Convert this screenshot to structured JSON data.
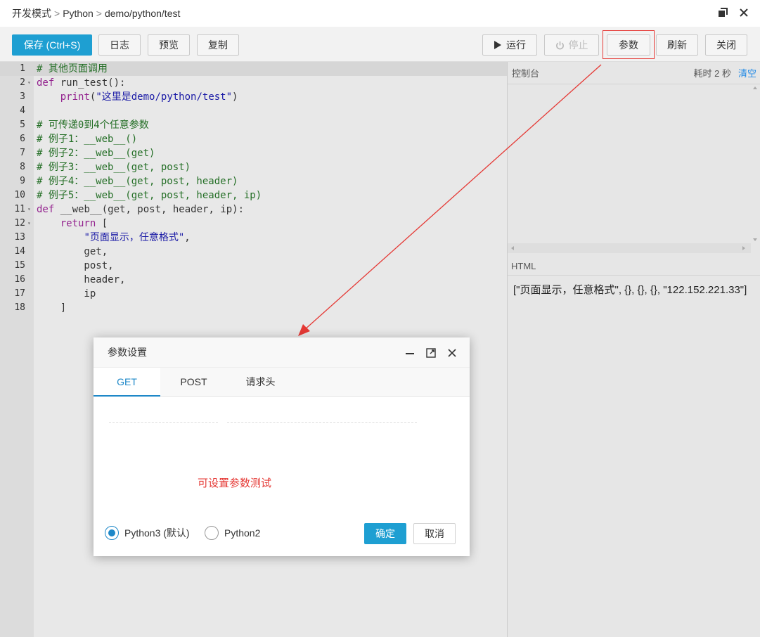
{
  "title": {
    "crumbs": [
      "开发模式",
      "Python",
      "demo/python/test"
    ],
    "separator": ">"
  },
  "toolbar": {
    "save": "保存 (Ctrl+S)",
    "log": "日志",
    "preview": "预览",
    "copy": "复制",
    "run": "运行",
    "stop": "停止",
    "params": "参数",
    "refresh": "刷新",
    "close": "关闭"
  },
  "editor": {
    "lines": [
      "# 其他页面调用",
      "def run_test():",
      "    print(\"这里是demo/python/test\")",
      "",
      "# 可传递0到4个任意参数",
      "# 例子1：__web__()",
      "# 例子2：__web__(get)",
      "# 例子3：__web__(get, post)",
      "# 例子4：__web__(get, post, header)",
      "# 例子5：__web__(get, post, header, ip)",
      "def __web__(get, post, header, ip):",
      "    return [",
      "        \"页面显示，任意格式\",",
      "        get,",
      "        post,",
      "        header,",
      "        ip",
      "    ]"
    ]
  },
  "console": {
    "label": "控制台",
    "elapsed": "耗时 2 秒",
    "clear": "清空"
  },
  "html_panel": {
    "label": "HTML",
    "output": "[\"页面显示，任意格式\", {}, {}, {}, \"122.152.221.33\"]"
  },
  "modal": {
    "title": "参数设置",
    "tabs": [
      "GET",
      "POST",
      "请求头"
    ],
    "hint": "可设置参数测试",
    "radio_py3": "Python3 (默认)",
    "radio_py2": "Python2",
    "ok": "确定",
    "cancel": "取消"
  },
  "colors": {
    "primary": "#1e9fd2",
    "accent_red": "#e53935",
    "tab_active": "#1e88c8"
  }
}
